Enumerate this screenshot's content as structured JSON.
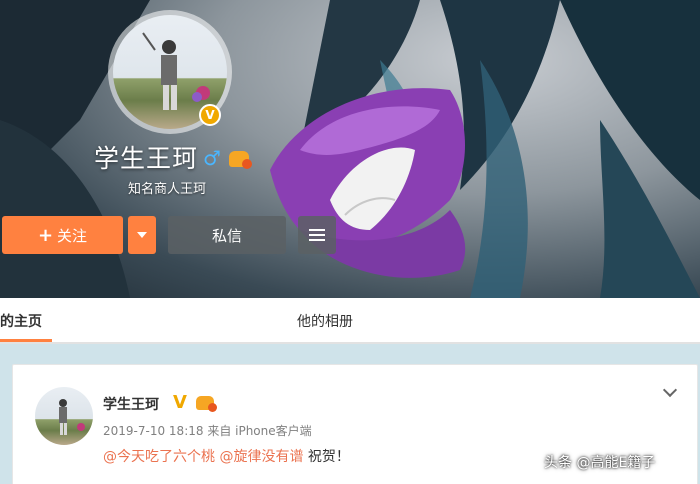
{
  "profile": {
    "name": "学生王珂",
    "description": "知名商人王珂",
    "verified_icon": "verified-v-icon",
    "gender_icon": "male-icon",
    "gender_symbol": "♂",
    "vip_icon": "vip-crown-icon"
  },
  "actions": {
    "follow_label": "关注",
    "follow_plus": "+",
    "message_label": "私信"
  },
  "tabs": [
    {
      "label": "的主页",
      "active": true
    },
    {
      "label": "他的相册",
      "active": false
    }
  ],
  "post": {
    "author": "学生王珂",
    "verified_symbol": "V",
    "time": "2019-7-10 18:18 来自 iPhone客户端",
    "mention1": "@今天吃了六个桃",
    "mention2": "@旋律没有谱",
    "text_tail": "祝贺！"
  },
  "watermark": "头条 @高能E籍子",
  "colors": {
    "accent": "#ff8140",
    "mention": "#eb7350",
    "verified": "#f0a800"
  }
}
